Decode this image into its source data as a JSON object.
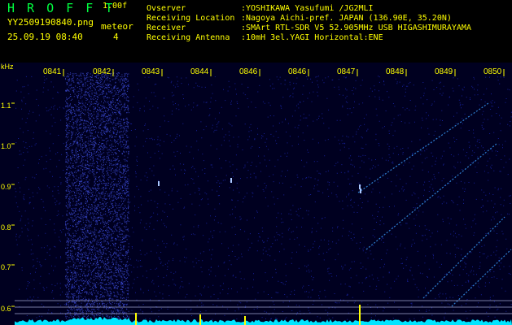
{
  "header": {
    "app_title": "H R O F F T",
    "version": "1.00f",
    "filename": "YY2509190840.png",
    "datetime": "25.09.19 08:40",
    "meteor_label": "meteor",
    "meteor_count": "4",
    "info": [
      {
        "label": "Ovserver",
        "value": ":YOSHIKAWA Yasufumi /JG2MLI"
      },
      {
        "label": "Receiving Location",
        "value": ":Nagoya Aichi-pref. JAPAN (136.90E, 35.20N)"
      },
      {
        "label": "Receiver",
        "value": ":SMArt RTL-SDR V5 52.905MHz USB HIGASHIMURAYAMA"
      },
      {
        "label": "Receiving Antenna",
        "value": ":10mH 3el.YAGI Horizontal:ENE"
      }
    ]
  },
  "plot": {
    "y_unit": "kHz",
    "y_ticks": [
      "1.1",
      "1.0",
      "0.9",
      "0.8",
      "0.7",
      "0.6"
    ],
    "time_labels": [
      "0841",
      "0842",
      "0843",
      "0844",
      "0846",
      "0846",
      "0847",
      "0848",
      "0849",
      "0850"
    ],
    "colors": {
      "background": "#000020",
      "noise": "#2a3dff",
      "trace": "#3aa0ff",
      "bottom_signal": "#00e5ff",
      "marker": "#ffff00",
      "label": "#ffff00"
    }
  }
}
